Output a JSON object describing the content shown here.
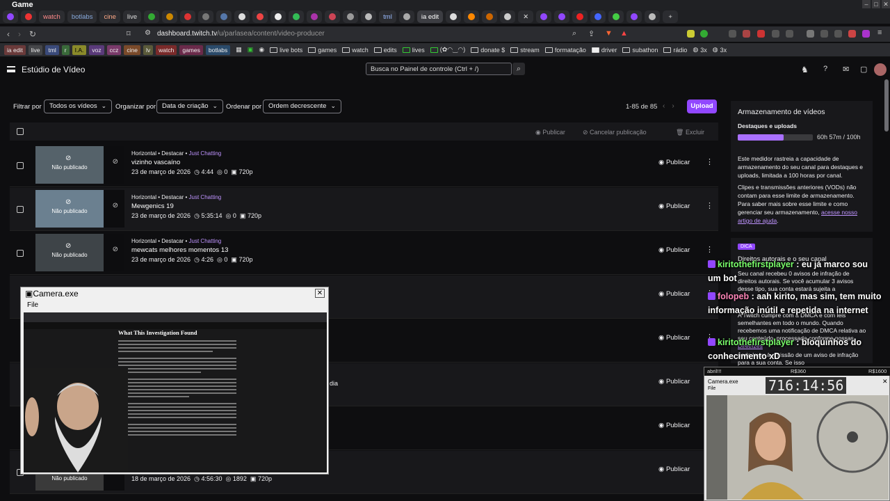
{
  "window": {
    "title": "Game"
  },
  "tabs": [
    "watch",
    "botlabs",
    "cine",
    "live",
    "tml",
    "ia edit"
  ],
  "address": {
    "url_host": "dashboard.twitch.tv",
    "url_path": "/u/parlasea/content/video-producer"
  },
  "bookmarks": {
    "chips": [
      "ia edit",
      "live",
      "tml",
      "r",
      "I.A.",
      "voz",
      "ccz",
      "cine",
      "lv",
      "watch",
      "games",
      "botlabs"
    ],
    "items": [
      "live bots",
      "games",
      "watch",
      "edits",
      "lives",
      "(✿◠‿◠)",
      "donate $",
      "stream",
      "formatação",
      "driver",
      "subathon",
      "rádio",
      "3x",
      "3x"
    ]
  },
  "header": {
    "title": "Estúdio de Vídeo",
    "search_placeholder": "Busca no Painel de controle (Ctrl + /)"
  },
  "filters": {
    "filter_label": "Filtrar por",
    "filter_value": "Todos os vídeos",
    "organize_label": "Organizar por",
    "organize_value": "Data de criação",
    "order_label": "Ordenar por",
    "order_value": "Ordem decrescente",
    "count": "1-85 de 85",
    "upload": "Upload"
  },
  "table_actions": {
    "publish": "Publicar",
    "cancel": "Cancelar publicação",
    "delete": "Excluir"
  },
  "rows": [
    {
      "meta": "Horizontal • Destacar •",
      "category": "Just Chatting",
      "title": "vizinho vascaíno",
      "date": "23 de março de 2026",
      "duration": "4:44",
      "views": "0",
      "quality": "720p",
      "status": "Não publicado",
      "action": "Publicar"
    },
    {
      "meta": "Horizontal • Destacar •",
      "category": "Just Chatting",
      "title": "Mewgenics 19",
      "date": "23 de março de 2026",
      "duration": "5:35:14",
      "views": "0",
      "quality": "720p",
      "status": "Não publicado",
      "action": "Publicar"
    },
    {
      "meta": "Horizontal • Destacar •",
      "category": "Just Chatting",
      "title": "mewcats melhores momentos 13",
      "date": "23 de março de 2026",
      "duration": "4:26",
      "views": "0",
      "quality": "720p",
      "status": "Não publicado",
      "action": "Publicar"
    },
    {
      "action": "Publicar"
    },
    {
      "action": "Publicar"
    },
    {
      "action": "Publicar",
      "partial": "dia"
    },
    {
      "action": "Publicar"
    },
    {
      "date": "18 de março de 2026",
      "duration": "4:56:30",
      "views": "1892",
      "quality": "720p",
      "status": "Não publicado",
      "action": "Publicar"
    }
  ],
  "storage": {
    "title": "Armazenamento de vídeos",
    "subtitle": "Destaques e uploads",
    "usage": "60h 57m / 100h",
    "usage_fraction": 0.61,
    "p1": "Este medidor rastreia a capacidade de armazenamento do seu canal para destaques e uploads, limitada a 100 horas por canal.",
    "p2": "Clipes e transmissões anteriores (VODs) não contam para esse limite de armazenamento. Para saber mais sobre esse limite e como gerenciar seu armazenamento,",
    "p2_link": "acesse nosso artigo de ajuda",
    "p2_end": "."
  },
  "tip": {
    "badge": "DICA",
    "title": "Direitos autorais e o seu canal",
    "p1": "Seu canal recebeu 0 avisos de infração de direitos autorais. Se você acumular 3 avisos desse tipo, sua conta estará sujeita a",
    "p2": "A Twitch cumpre com a DMCA e com leis semelhantes em todo o mundo. Quando recebemos uma notificação de DMCA relativa ao seu conteúdo, processada conforme nossas",
    "p2_link": "Diretrizes",
    "p3": "pode levar à emissão de um aviso de infração para a sua conta. Se isso"
  },
  "chat": [
    {
      "user": "kiritothefirstplayer",
      "sep": " : ",
      "msg": "eu já marco sou um bot"
    },
    {
      "user": "folopeb",
      "sep": " : ",
      "msg": "aah kirito, mas sim, tem muito informação inútil e repetida na internet"
    },
    {
      "user": "kiritothefirstplayer",
      "sep": " : ",
      "msg": "bloquinhos do conhecimento xD"
    }
  ],
  "camera": {
    "title": "Camera.exe",
    "menu": "File",
    "doc_heading": "What This Investigation Found"
  },
  "camera2": {
    "top_left": "abril!!!",
    "top_mid": "R$360",
    "top_right": "R$1600",
    "title": "Camera.exe",
    "menu": "File",
    "clock": "716:14:56"
  },
  "colors": {
    "accent": "#9147ff",
    "link": "#bf94ff"
  }
}
